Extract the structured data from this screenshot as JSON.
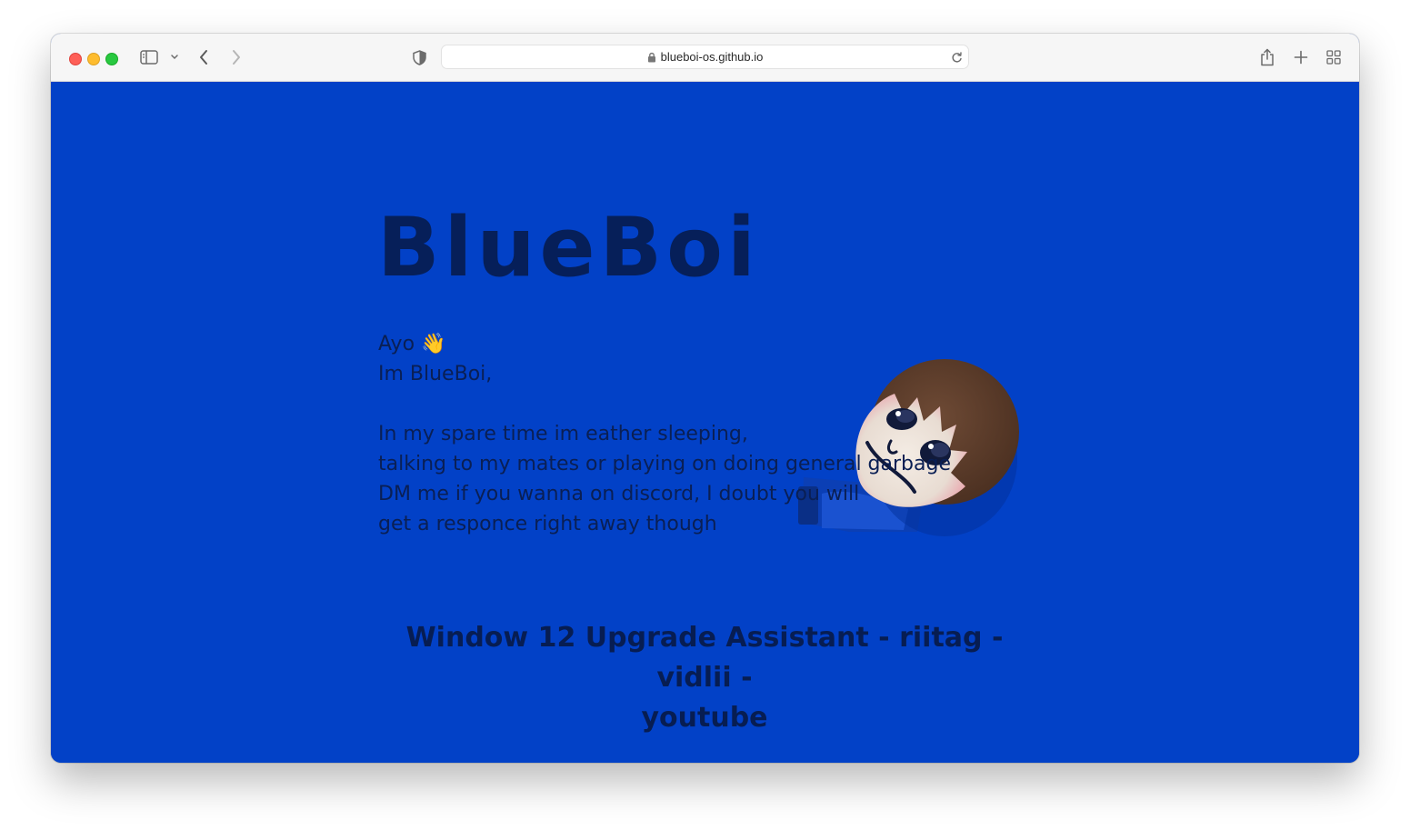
{
  "browser": {
    "url": "blueboi-os.github.io",
    "icons": {
      "sidebar": "sidebar-icon",
      "sidebar_menu": "chevron-down-icon",
      "back": "back-arrow-icon",
      "forward": "forward-arrow-icon",
      "privacy": "shield-icon",
      "lock": "lock-icon",
      "reload": "reload-icon",
      "share": "share-icon",
      "new_tab": "plus-icon",
      "tab_overview": "grid-icon"
    }
  },
  "page": {
    "title": "BlueBoi",
    "greeting": "Ayo 👋",
    "intro": "Im BlueBoi,",
    "bio": [
      "In my spare time im eather sleeping,",
      "talking to my mates or playing on doing general garbage",
      "DM me if you wanna on discord, I doubt you will",
      "get a responce right away though"
    ],
    "links": {
      "upgrade": "Window 12 Upgrade Assistant",
      "sep1": " - ",
      "riitag": "riitag",
      "sep2": " - ",
      "vidlii": "vidlii",
      "sep3": " -",
      "youtube": "youtube"
    },
    "colors": {
      "background": "#0241c7",
      "text": "#061f59"
    }
  }
}
